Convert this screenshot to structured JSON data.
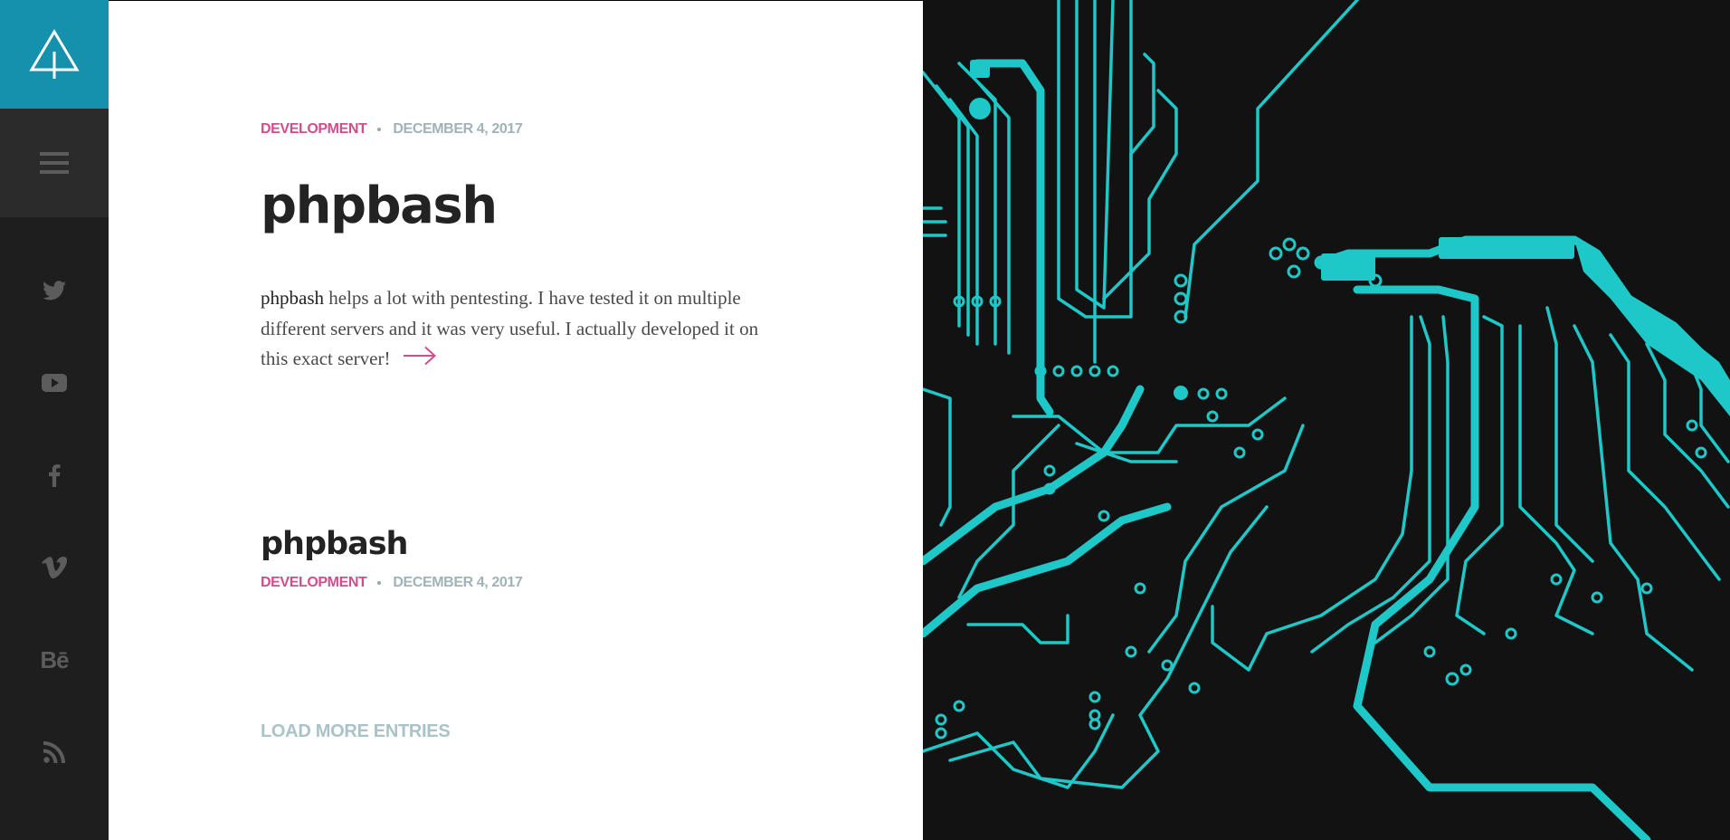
{
  "sidebar": {
    "logo_icon": "tree-logo-icon",
    "menu_icon": "hamburger-menu-icon",
    "social_icons": [
      "twitter-icon",
      "youtube-icon",
      "facebook-icon",
      "vimeo-icon",
      "behance-icon",
      "rss-icon"
    ],
    "behance_text": "Bē",
    "colors": {
      "logo_bg": "#1591ad",
      "menu_bg": "#2b2b2b",
      "sidebar_bg": "#1e1e1e",
      "icon": "#5c5c5c"
    }
  },
  "posts": [
    {
      "category": "DEVELOPMENT",
      "date": "DECEMBER 4, 2017",
      "title": "phpbash",
      "excerpt_lead": "phpbash",
      "excerpt_rest": " helps a lot with pentesting. I have tested it on multiple different servers and it was very useful. I actually developed it on this exact server!",
      "more_icon": "arrow-right-icon"
    },
    {
      "title": "phpbash",
      "category": "DEVELOPMENT",
      "date": "DECEMBER 4, 2017"
    }
  ],
  "load_more_label": "LOAD MORE ENTRIES",
  "hero": {
    "icon": "circuit-board-image",
    "colors": {
      "background": "#121212",
      "trace": "#1fc8c8"
    }
  },
  "colors": {
    "category": "#d14d8c",
    "date": "#9fb3b8",
    "title": "#232323",
    "load_more": "#a9c3c8"
  }
}
